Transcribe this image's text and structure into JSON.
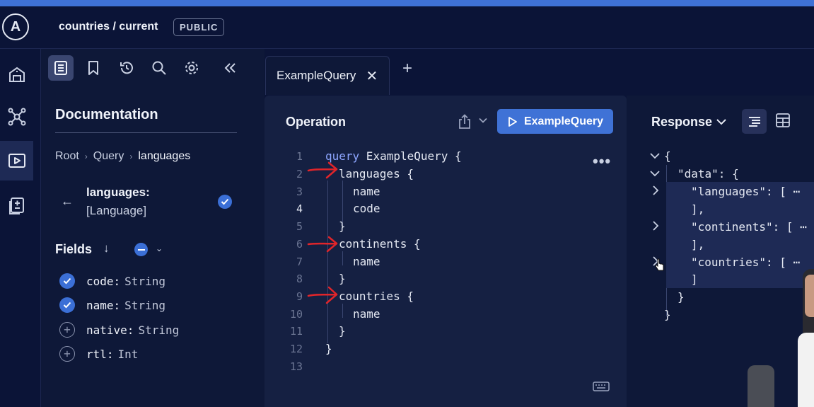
{
  "header": {
    "graph_title": "countries / current",
    "badge": "PUBLIC",
    "logo_letter": "A"
  },
  "leftnav": {
    "items": [
      {
        "icon": "schema-icon"
      },
      {
        "icon": "graph-nodes-icon"
      },
      {
        "icon": "explorer-play-icon",
        "active": true
      },
      {
        "icon": "checks-icon"
      }
    ]
  },
  "doc_toolbar": {
    "icons": [
      "documentation-icon",
      "bookmark-icon",
      "history-icon",
      "search-icon",
      "settings-icon",
      "collapse-icon"
    ]
  },
  "documentation": {
    "title": "Documentation",
    "breadcrumb": [
      "Root",
      "Query",
      "languages"
    ],
    "field_name": "languages:",
    "field_type": "[Language]",
    "fields_label": "Fields",
    "fields": [
      {
        "name": "code:",
        "type": "String",
        "selected": true
      },
      {
        "name": "name:",
        "type": "String",
        "selected": true
      },
      {
        "name": "native:",
        "type": "String",
        "selected": false
      },
      {
        "name": "rtl:",
        "type": "Int",
        "selected": false
      }
    ]
  },
  "tabs": {
    "active_label": "ExampleQuery",
    "close": "✕",
    "add": "+"
  },
  "operation": {
    "title": "Operation",
    "run_label": "ExampleQuery",
    "lines": [
      {
        "n": "1",
        "kw": "query",
        "text": " ExampleQuery {"
      },
      {
        "n": "2",
        "text": "languages {"
      },
      {
        "n": "3",
        "text": "name"
      },
      {
        "n": "4",
        "text": "code"
      },
      {
        "n": "5",
        "text": "}"
      },
      {
        "n": "6",
        "text": "continents {"
      },
      {
        "n": "7",
        "text": "name"
      },
      {
        "n": "8",
        "text": "}"
      },
      {
        "n": "9",
        "text": "countries {"
      },
      {
        "n": "10",
        "text": "name"
      },
      {
        "n": "11",
        "text": "}"
      },
      {
        "n": "12",
        "text": "}"
      },
      {
        "n": "13",
        "text": ""
      }
    ]
  },
  "response": {
    "title": "Response",
    "lines": [
      {
        "text": "{"
      },
      {
        "text": "\"data\": {"
      },
      {
        "text": "\"languages\": [ ⋯"
      },
      {
        "text": "],"
      },
      {
        "text": "\"continents\": [ ⋯"
      },
      {
        "text": "],"
      },
      {
        "text": "\"countries\": [ ⋯"
      },
      {
        "text": "]"
      },
      {
        "text": "}"
      },
      {
        "text": "}"
      }
    ]
  },
  "colors": {
    "accent": "#3f72d6",
    "background": "#0b1437",
    "panel": "#152042",
    "annotation": "#e0252a"
  }
}
